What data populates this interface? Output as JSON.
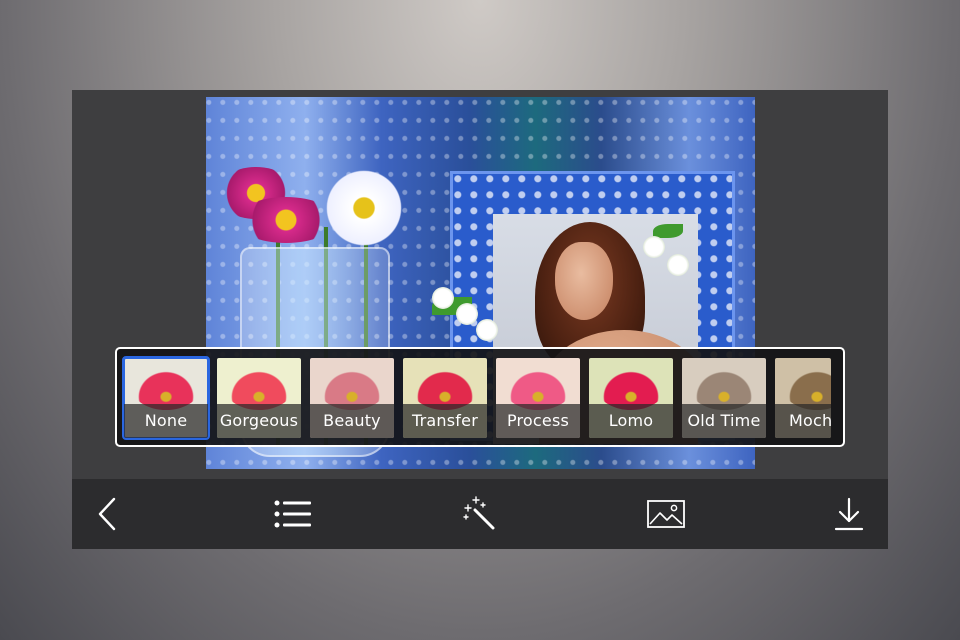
{
  "editor": {
    "filters": [
      {
        "label": "None",
        "selected": true,
        "bg": "#e8e6dc",
        "petal": "#e8325a",
        "tone": "none"
      },
      {
        "label": "Gorgeous",
        "selected": false,
        "bg": "#eef0cf",
        "petal": "#f04b5d",
        "tone": "warm"
      },
      {
        "label": "Beauty",
        "selected": false,
        "bg": "#ead6cc",
        "petal": "#d97a86",
        "tone": "soft"
      },
      {
        "label": "Transfer",
        "selected": false,
        "bg": "#e6e1b8",
        "petal": "#e22a4c",
        "tone": "yellow"
      },
      {
        "label": "Process",
        "selected": false,
        "bg": "#f1ddd2",
        "petal": "#ef5a86",
        "tone": "pink"
      },
      {
        "label": "Lomo",
        "selected": false,
        "bg": "#dde3b8",
        "petal": "#e31c50",
        "tone": "contrast"
      },
      {
        "label": "Old Time",
        "selected": false,
        "bg": "#d8cdbf",
        "petal": "#9b8676",
        "tone": "gray"
      },
      {
        "label": "Moch",
        "selected": false,
        "bg": "#cfc0a6",
        "petal": "#8a6e4c",
        "tone": "sepia"
      }
    ]
  },
  "toolbar": {
    "icons": [
      "back-chevron-icon",
      "list-icon",
      "magic-wand-icon",
      "image-icon",
      "download-icon"
    ]
  },
  "colors": {
    "selection": "#2a66e0",
    "toolbar_bg": "#2c2c2e",
    "workspace_bg": "#3e3e40"
  }
}
